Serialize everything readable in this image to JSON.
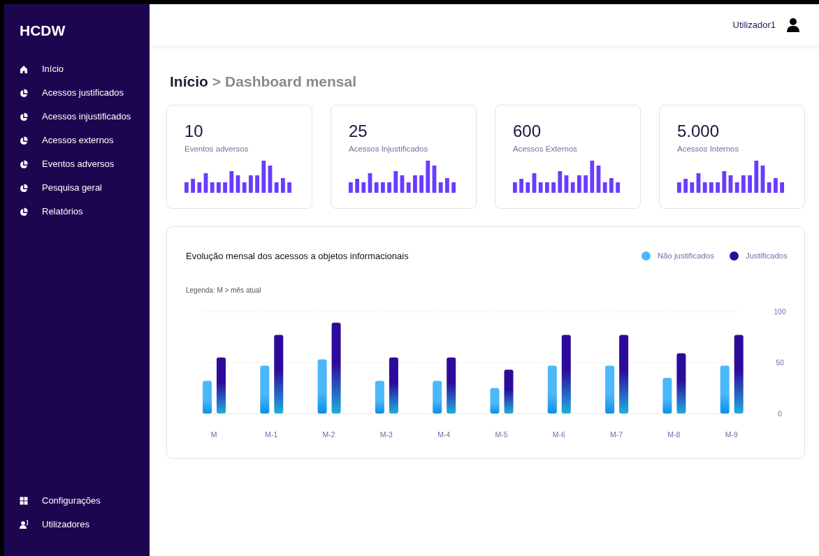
{
  "sidebar": {
    "brand": "HCDW",
    "items": [
      {
        "label": "Início",
        "kind": "home"
      },
      {
        "label": "Acessos justificados",
        "kind": "pie"
      },
      {
        "label": "Acessos injustificados",
        "kind": "pie"
      },
      {
        "label": "Acessos externos",
        "kind": "pie"
      },
      {
        "label": "Eventos adversos",
        "kind": "pie"
      },
      {
        "label": "Pesquisa geral",
        "kind": "pie"
      },
      {
        "label": "Relatórios",
        "kind": "pie"
      }
    ],
    "bottom_items": [
      {
        "label": "Configurações",
        "kind": "grid"
      },
      {
        "label": "Utilizadores",
        "kind": "users"
      }
    ]
  },
  "header": {
    "user": "Utilizador1"
  },
  "breadcrumb": {
    "current": "Início",
    "separator": ">",
    "page": "Dashboard mensal"
  },
  "stat_cards": [
    {
      "value": "10",
      "label": "Eventos adversos"
    },
    {
      "value": "25",
      "label": "Acessos Injustificados"
    },
    {
      "value": "600",
      "label": "Acessos Externos"
    },
    {
      "value": "5.000",
      "label": "Acessos Internos"
    }
  ],
  "chart_panel": {
    "title": "Evolução mensal dos acessos a objetos informacionais",
    "note": "Legenda: M > mês atual",
    "chart_data": {
      "type": "bar",
      "categories": [
        "M",
        "M-1",
        "M-2",
        "M-3",
        "M-4",
        "M-5",
        "M-6",
        "M-7",
        "M-8",
        "M-9"
      ],
      "series": [
        {
          "name": "Não justificados",
          "color": "#4bb8fb",
          "values": [
            32,
            47,
            53,
            32,
            32,
            25,
            47,
            47,
            35,
            47
          ]
        },
        {
          "name": "Justificados",
          "color": "#2c0b9b",
          "values": [
            55,
            77,
            89,
            55,
            55,
            43,
            77,
            77,
            59,
            77
          ]
        }
      ],
      "ylim": [
        0,
        100
      ],
      "yticks": [
        0,
        50,
        100
      ]
    }
  }
}
